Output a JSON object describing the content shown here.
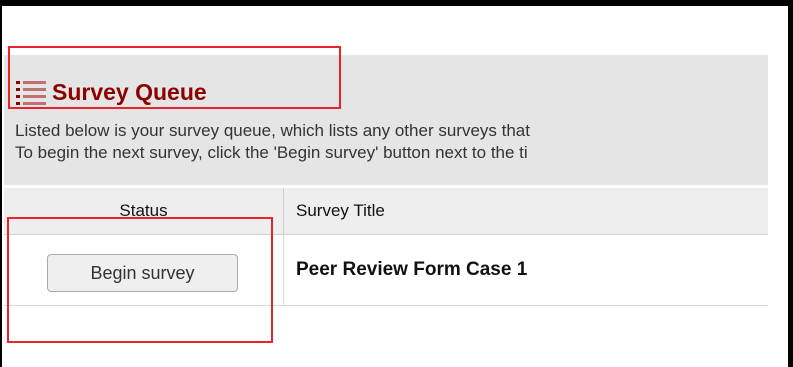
{
  "header": {
    "icon": "list-icon",
    "title": "Survey Queue"
  },
  "description": {
    "line1": "Listed below is your survey queue, which lists any other surveys that",
    "line2": "To begin the next survey, click the 'Begin survey' button next to the ti"
  },
  "table": {
    "columns": [
      "Status",
      "Survey Title"
    ],
    "rows": [
      {
        "action_label": "Begin survey",
        "survey_title": "Peer Review Form Case 1"
      }
    ]
  },
  "colors": {
    "title": "#8b0000",
    "highlight": "#e8232b"
  }
}
